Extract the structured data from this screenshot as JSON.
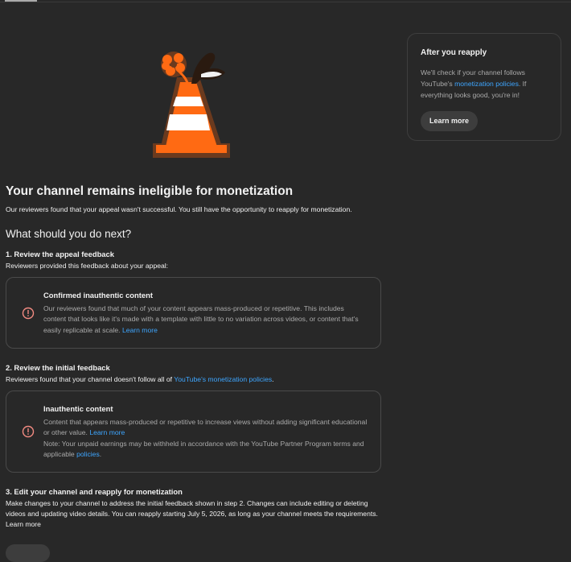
{
  "side": {
    "title": "After you reapply",
    "text_before": "We'll check if your channel follows YouTube's ",
    "link": "monetization policies",
    "text_after": ". If everything looks good, you're in!",
    "button": "Learn more"
  },
  "main": {
    "title": "Your channel remains ineligible for monetization",
    "subtitle": "Our reviewers found that your appeal wasn't successful. You still have the opportunity to reapply for monetization.",
    "next_heading": "What should you do next?"
  },
  "step1": {
    "title": "1. Review the appeal feedback",
    "desc": "Reviewers provided this feedback about your appeal:",
    "card_title": "Confirmed inauthentic content",
    "card_text": "Our reviewers found that much of your content appears mass-produced or repetitive. This includes content that looks like it's made with a template with little to no variation across videos, or content that's easily replicable at scale.",
    "card_link": "Learn more"
  },
  "step2": {
    "title": "2. Review the initial feedback",
    "desc_before": "Reviewers found that your channel doesn't follow all of ",
    "desc_link": "YouTube's monetization policies",
    "desc_after": ".",
    "card_title": "Inauthentic content",
    "card_text": "Content that appears mass-produced or repetitive to increase views without adding significant educational or other value.",
    "card_link": "Learn more",
    "note_before": "Note: Your unpaid earnings may be withheld in accordance with the YouTube Partner Program terms and applicable ",
    "note_link": "policies",
    "note_after": "."
  },
  "step3": {
    "title": "3. Edit your channel and reapply for monetization",
    "desc": "Make changes to your channel to address the initial feedback shown in step 2. Changes can include editing or deleting videos and updating video details. You can reapply starting July 5, 2026, as long as your channel meets the requirements.",
    "link": "Learn more"
  },
  "colors": {
    "background": "#282828",
    "link": "#3ea6ff",
    "alert": "#f28b82",
    "cone": "#ff6a13"
  },
  "icons": {
    "alert": "error-circle-icon",
    "illustration": "traffic-cone-icon"
  }
}
